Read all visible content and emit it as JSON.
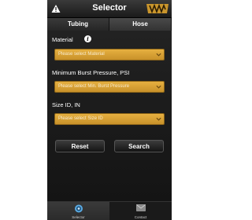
{
  "header": {
    "title": "Selector"
  },
  "tabs": [
    {
      "label": "Tubing",
      "active": false
    },
    {
      "label": "Hose",
      "active": true
    }
  ],
  "form": {
    "material": {
      "label": "Material",
      "placeholder": "Please select Material"
    },
    "burst": {
      "label": "Minimum Burst Pressure, PSI",
      "placeholder": "Please select Min. Burst Pressure"
    },
    "size": {
      "label": "Size ID, IN",
      "placeholder": "Please select Size ID"
    },
    "reset_label": "Reset",
    "search_label": "Search"
  },
  "bottom_nav": [
    {
      "label": "Selector",
      "icon": "selector-icon",
      "active": true
    },
    {
      "label": "Contact",
      "icon": "mail-icon",
      "active": false
    }
  ],
  "colors": {
    "accent": "#d9a236",
    "background": "#0b0b0b"
  }
}
